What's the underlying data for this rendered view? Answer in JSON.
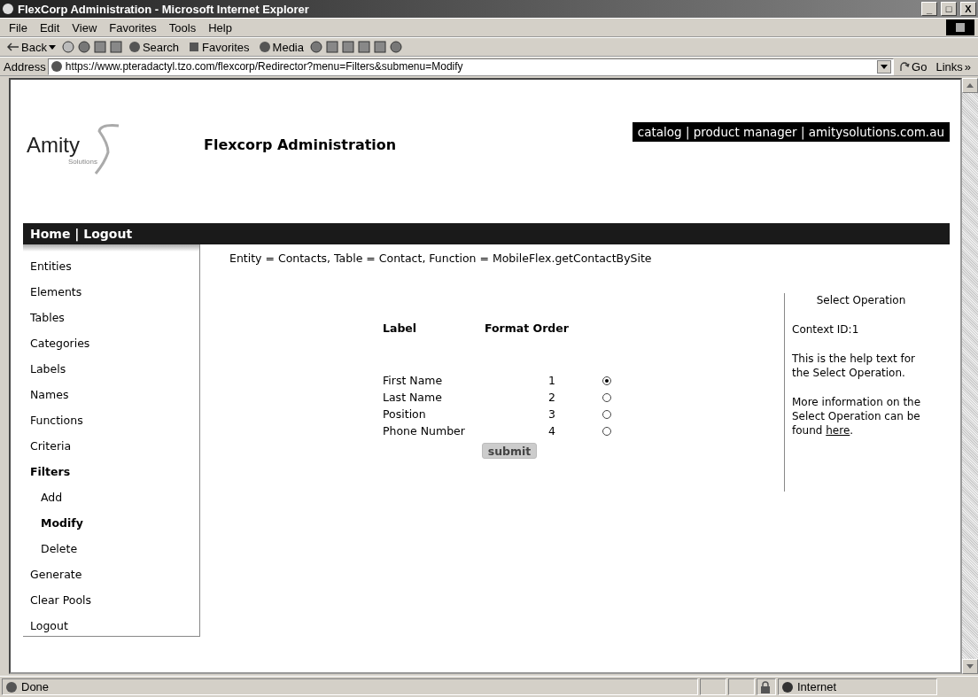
{
  "window": {
    "title": "FlexCorp Administration - Microsoft Internet Explorer",
    "controls": [
      "_",
      "□",
      "X"
    ]
  },
  "menu": [
    "File",
    "Edit",
    "View",
    "Favorites",
    "Tools",
    "Help"
  ],
  "toolbar": {
    "back": "Back",
    "search": "Search",
    "favorites": "Favorites",
    "media": "Media"
  },
  "address": {
    "label": "Address",
    "url": "https://www.pteradactyl.tzo.com/flexcorp/Redirector?menu=Filters&submenu=Modify",
    "go": "Go",
    "links": "Links",
    "more": "»"
  },
  "header": {
    "logo": "Amity",
    "logo_sub": "Solutions",
    "title": "Flexcorp Administration",
    "top_links": "catalog | product manager | amitysolutions.com.au"
  },
  "nav": "Home | Logout",
  "sidebar": [
    {
      "label": "Entities",
      "selected": false
    },
    {
      "label": "Elements",
      "selected": false
    },
    {
      "label": "Tables",
      "selected": false
    },
    {
      "label": "Categories",
      "selected": false
    },
    {
      "label": "Labels",
      "selected": false
    },
    {
      "label": "Names",
      "selected": false
    },
    {
      "label": "Functions",
      "selected": false
    },
    {
      "label": "Criteria",
      "selected": false
    },
    {
      "label": "Filters",
      "selected": true,
      "children": [
        {
          "label": "Add",
          "selected": false
        },
        {
          "label": "Modify",
          "selected": true
        },
        {
          "label": "Delete",
          "selected": false
        }
      ]
    },
    {
      "label": "Generate",
      "selected": false
    },
    {
      "label": "Clear Pools",
      "selected": false
    },
    {
      "label": "Logout",
      "selected": false
    }
  ],
  "context": "Entity = Contacts, Table = Contact, Function = MobileFlex.getContactBySite",
  "table": {
    "columns": [
      "Label",
      "Format Order"
    ],
    "rows": [
      {
        "label": "First Name",
        "order": "1",
        "selected": true
      },
      {
        "label": "Last Name",
        "order": "2",
        "selected": false
      },
      {
        "label": "Position",
        "order": "3",
        "selected": false
      },
      {
        "label": "Phone Number",
        "order": "4",
        "selected": false
      }
    ]
  },
  "submit": "submit",
  "help": {
    "title": "Select Operation",
    "context_id": "Context ID:1",
    "text": "This is the help text for the Select Operation.",
    "more": "More information on the Select Operation can be found",
    "link": "here",
    "end": "."
  },
  "status_bar": {
    "text": "Done",
    "zone": "Internet"
  }
}
